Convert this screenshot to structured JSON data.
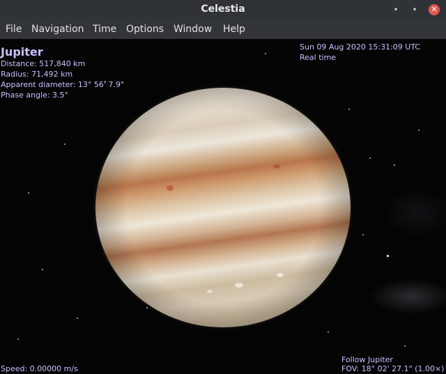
{
  "window": {
    "title": "Celestia",
    "controls": {
      "minimize": "•",
      "maximize": "•",
      "close": "✕"
    }
  },
  "menu": [
    "File",
    "Navigation",
    "Time",
    "Options",
    "Window",
    "Help"
  ],
  "selection": {
    "name": "Jupiter",
    "distance": "Distance: 517,840 km",
    "radius": "Radius: 71,492 km",
    "apparent_diameter": "Apparent diameter: 13° 56' 7.9\"",
    "phase_angle": "Phase angle: 3.5°"
  },
  "time": {
    "datetime": "Sun 09 Aug 2020 15:31:09 UTC",
    "mode": "Real time"
  },
  "status": {
    "speed": "Speed: 0.00000 m/s",
    "follow": "Follow Jupiter",
    "fov": "FOV: 18° 02' 27.1\" (1.00×)"
  },
  "colors": {
    "hud_text": "#c9c2ff",
    "title_bar": "#2f3338",
    "menu_bar": "#31353a",
    "close_button": "#e05a4f"
  }
}
